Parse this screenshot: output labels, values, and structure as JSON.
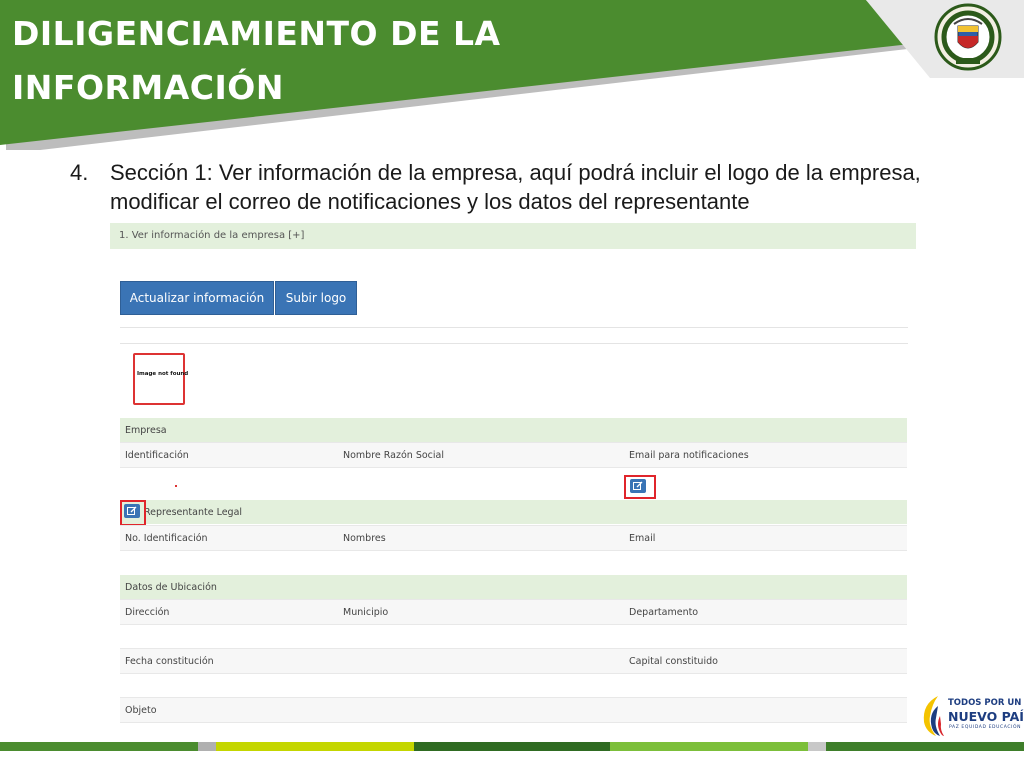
{
  "header": {
    "title_line1": "DILIGENCIAMIENTO DE LA",
    "title_line2": "INFORMACIÓN",
    "colors": {
      "banner": "#4b8c2f",
      "banner_shadow": "#bdbdbd"
    }
  },
  "instruction": {
    "number": "4.",
    "text": "Sección 1: Ver información de la empresa, aquí podrá incluir el logo de la empresa, modificar el correo de notificaciones y los datos del representante"
  },
  "screenshot": {
    "section_title": "1. Ver información de la empresa [+]",
    "buttons": {
      "update_label": "Actualizar información",
      "upload_logo_label": "Subir logo"
    },
    "image_placeholder": "Image not found",
    "empresa": {
      "title": "Empresa",
      "columns": [
        "Identificación",
        "Nombre Razón Social",
        "Email para notificaciones"
      ]
    },
    "representante": {
      "title": "Representante Legal",
      "columns": [
        "No. Identificación",
        "Nombres",
        "Email"
      ]
    },
    "ubicacion": {
      "title": "Datos de Ubicación",
      "columns": [
        "Dirección",
        "Municipio",
        "Departamento"
      ],
      "row2": [
        "Fecha constitución",
        "Capital constituido"
      ],
      "row3": [
        "Objeto"
      ]
    },
    "colors": {
      "section_bg": "#e3f0dc",
      "button": "#3a74b5",
      "highlight": "#e0252b"
    },
    "icons": {
      "edit": "edit-icon"
    }
  },
  "brand": {
    "line1": "TODOS POR UN",
    "line2": "NUEVO PAÍS",
    "line3": "PAZ  EQUIDAD  EDUCACIÓN"
  }
}
